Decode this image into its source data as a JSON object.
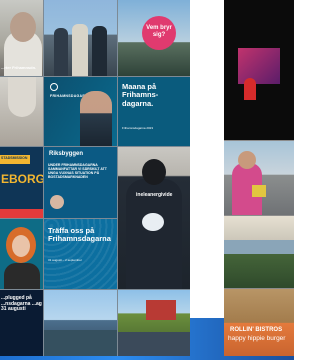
{
  "grid": {
    "r1": {
      "man_caption": "...rter Frihamnsdn.",
      "badge_text": "Vem bryr sig?"
    },
    "r2": {
      "logo_text": "FRIHAMNSDAGARNA",
      "maana_title": "Maana på Frihamns-dagarna.",
      "maana_small": "Frihamnsdagarna 2023"
    },
    "r3": {
      "left_badge": "STADSMISSION",
      "left_big": "EBORG",
      "riks_logo": "Riksbyggen",
      "riks_text": "UNDER FRIHAMNSDAGARNA SAMMANFATTAR VI SÄRSKILT ATT UNGA VUXNAS SITUATION PÅ BOSTADSMARKNADEN",
      "vest_text": "ineleanergivide"
    },
    "r4": {
      "traffa": "Träffa oss på Frihamnsdagarna",
      "traffa_small": "31 augusti – 2 september"
    },
    "r5": {
      "left_text": "...plugged på ...nsdagarna ...ag 31 augusti"
    }
  },
  "right": {
    "food_truck": "ROLLIN' BISTROS",
    "food_truck_sub": "happy hippie burger"
  }
}
